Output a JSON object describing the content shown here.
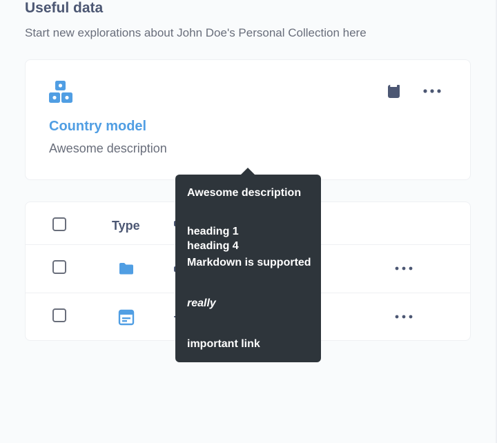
{
  "section": {
    "title": "Useful data",
    "subtitle": "Start new explorations about John Doe's Personal Collection here"
  },
  "pinned_model": {
    "name": "Country model",
    "description": "Awesome description",
    "icon": "model-icon",
    "actions": [
      "bookmark-icon",
      "ellipsis-icon"
    ]
  },
  "items_table": {
    "columns": [
      {
        "label": "Type"
      }
    ],
    "rows": [
      {
        "icon": "folder-icon",
        "menu_icon": "ellipsis-icon"
      },
      {
        "icon": "table-icon",
        "menu_icon": "ellipsis-icon"
      }
    ]
  },
  "tooltip": {
    "lines": [
      "Awesome description",
      "heading 1",
      "heading 4",
      "Markdown is supported",
      "really",
      "important link"
    ]
  },
  "colors": {
    "brand": "#509ee3",
    "text_dark": "#4c5773",
    "text_medium": "#696e7b",
    "tooltip_bg": "#2e353b",
    "border": "#eef0f3"
  }
}
